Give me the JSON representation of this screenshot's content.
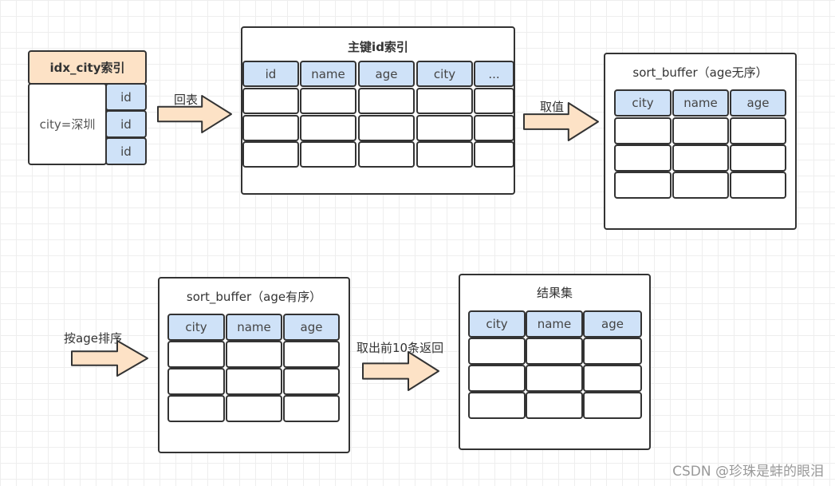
{
  "colors": {
    "index_header": "#fde2c6",
    "column_header": "#cfe2f8",
    "arrow": "#fde2c6",
    "border": "#333333"
  },
  "index": {
    "title": "idx_city索引",
    "key": "city=深圳",
    "ids": [
      "id",
      "id",
      "id"
    ]
  },
  "primary": {
    "title": "主键id索引",
    "columns": [
      "id",
      "name",
      "age",
      "city",
      "..."
    ]
  },
  "sort_unordered": {
    "title": "sort_buffer（age无序）",
    "columns": [
      "city",
      "name",
      "age"
    ]
  },
  "sort_ordered": {
    "title": "sort_buffer（age有序）",
    "columns": [
      "city",
      "name",
      "age"
    ]
  },
  "result": {
    "title": "结果集",
    "columns": [
      "city",
      "name",
      "age"
    ]
  },
  "arrows": {
    "back_to_table": "回表",
    "fetch_values": "取值",
    "sort_by_age": "按age排序",
    "return_top10": "取出前10条返回"
  },
  "watermark": "CSDN @珍珠是蚌的眼泪"
}
